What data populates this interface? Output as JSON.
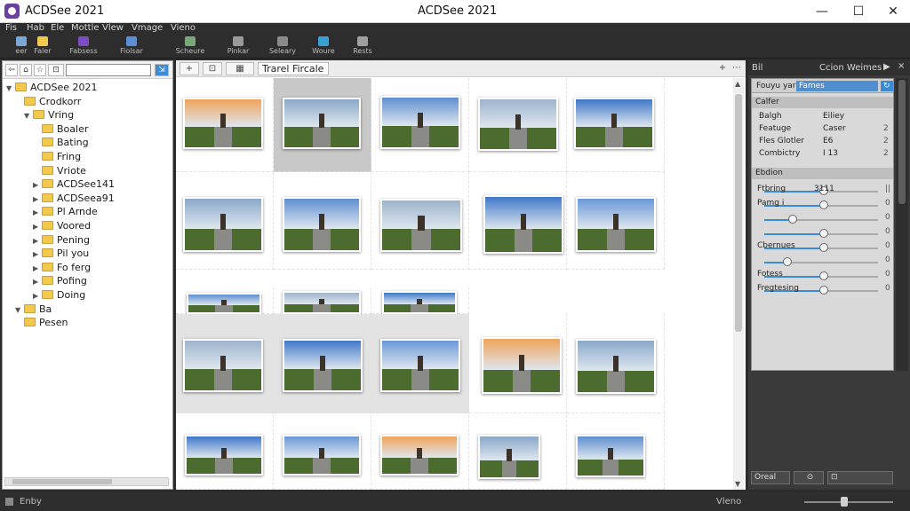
{
  "window": {
    "app_title": "ACDSee 2021",
    "center_title": "ACDSee 2021",
    "minimize": "—",
    "maximize": "☐",
    "close": "✕"
  },
  "menu": [
    "Fis",
    "Hab",
    "Ele",
    "Mottle",
    "Vlew",
    "Vmage",
    "Vieno"
  ],
  "toolbar": [
    {
      "label": "eer",
      "icon": "image-icon",
      "color": "#7aa7d6"
    },
    {
      "label": "Faler",
      "icon": "folder-icon",
      "color": "#f2c94c"
    },
    {
      "label": "Fabsess",
      "icon": "manage-icon",
      "color": "#7d4cc2"
    },
    {
      "label": "Fiolsar",
      "icon": "photos-icon",
      "color": "#5b8fd8"
    },
    {
      "label": "Scheure",
      "icon": "view-icon",
      "color": "#78a878"
    },
    {
      "label": "Pinkar",
      "icon": "develop-icon",
      "color": "#9a9a9a"
    },
    {
      "label": "Seleary",
      "icon": "edit-icon",
      "color": "#8a8a8a"
    },
    {
      "label": "Woure",
      "icon": "online-icon",
      "color": "#3aa0d8"
    },
    {
      "label": "Rests",
      "icon": "dashboard-icon",
      "color": "#a0a0a0"
    }
  ],
  "left_panel": {
    "chips": [
      "⇦",
      "⌂",
      "☆",
      "⊡",
      "▤",
      "⇲"
    ],
    "tree": [
      {
        "label": "ACDSee 2021",
        "arrow": "▼",
        "indent": 0
      },
      {
        "label": "Crodkorr",
        "arrow": "",
        "indent": 1
      },
      {
        "label": "Vring",
        "arrow": "▼",
        "indent": 2
      },
      {
        "label": "Boaler",
        "arrow": "",
        "indent": 3
      },
      {
        "label": "Bating",
        "arrow": "",
        "indent": 3
      },
      {
        "label": "Fring",
        "arrow": "",
        "indent": 3
      },
      {
        "label": "Vriote",
        "arrow": "",
        "indent": 3
      },
      {
        "label": "ACDSee141",
        "arrow": "▶",
        "indent": 3
      },
      {
        "label": "ACDSeea91",
        "arrow": "▶",
        "indent": 3
      },
      {
        "label": "Pl Arnde",
        "arrow": "▶",
        "indent": 3
      },
      {
        "label": "Voored",
        "arrow": "▶",
        "indent": 3
      },
      {
        "label": "Pening",
        "arrow": "▶",
        "indent": 3
      },
      {
        "label": "Pil you",
        "arrow": "▶",
        "indent": 3
      },
      {
        "label": "Fo ferg",
        "arrow": "▶",
        "indent": 3
      },
      {
        "label": "Pofing",
        "arrow": "▶",
        "indent": 3
      },
      {
        "label": "Doing",
        "arrow": "▶",
        "indent": 3
      },
      {
        "label": "Ba",
        "arrow": "▼",
        "indent": 1
      },
      {
        "label": "Pesen",
        "arrow": "",
        "indent": 1
      }
    ]
  },
  "center": {
    "buttons": [
      "+",
      "⊡",
      "▦",
      "▸"
    ],
    "breadcrumb": "Trarel Fircale",
    "add": "+",
    "more": "⋯",
    "scroll_up": "▲",
    "scroll_down": "▼"
  },
  "right_panel": {
    "title_left": "Bil",
    "title_right": "Ccion Weimes",
    "play": "▶",
    "close": "×",
    "tabs": [
      "Fouyu yar",
      "Fames"
    ],
    "sections": [
      {
        "title": "Calfer",
        "rows": [
          {
            "k": "Balgh",
            "v": "Eiliey",
            "e": ""
          },
          {
            "k": "Featuge",
            "v": "Caser",
            "e": "2"
          },
          {
            "k": "Fles Glotler",
            "v": "E6",
            "e": "2"
          },
          {
            "k": "Combictry",
            "v": "I 13",
            "e": "2"
          }
        ]
      },
      {
        "title": "Ebdion",
        "sliders": [
          {
            "label": "Ftbring",
            "extra": "3111",
            "value": "||",
            "fraction": 0.52
          },
          {
            "label": "Pamg i",
            "extra": "",
            "value": "0",
            "fraction": 0.52
          },
          {
            "label": "",
            "extra": "",
            "value": "0",
            "fraction": 0.25
          },
          {
            "label": "",
            "extra": "",
            "value": "0",
            "fraction": 0.52
          },
          {
            "label": "Cbernues",
            "extra": "",
            "value": "0",
            "fraction": 0.52
          },
          {
            "label": "",
            "extra": "",
            "value": "0",
            "fraction": 0.2
          },
          {
            "label": "Fotess",
            "extra": "",
            "value": "0",
            "fraction": 0.52
          },
          {
            "label": "Fregtesing",
            "extra": "",
            "value": "0",
            "fraction": 0.52
          }
        ]
      }
    ],
    "bottom": [
      "Oreal",
      "⊙",
      "⊡"
    ]
  },
  "status": {
    "left": "Enby",
    "right": "Vleno",
    "zoom_fraction": 0.45
  }
}
